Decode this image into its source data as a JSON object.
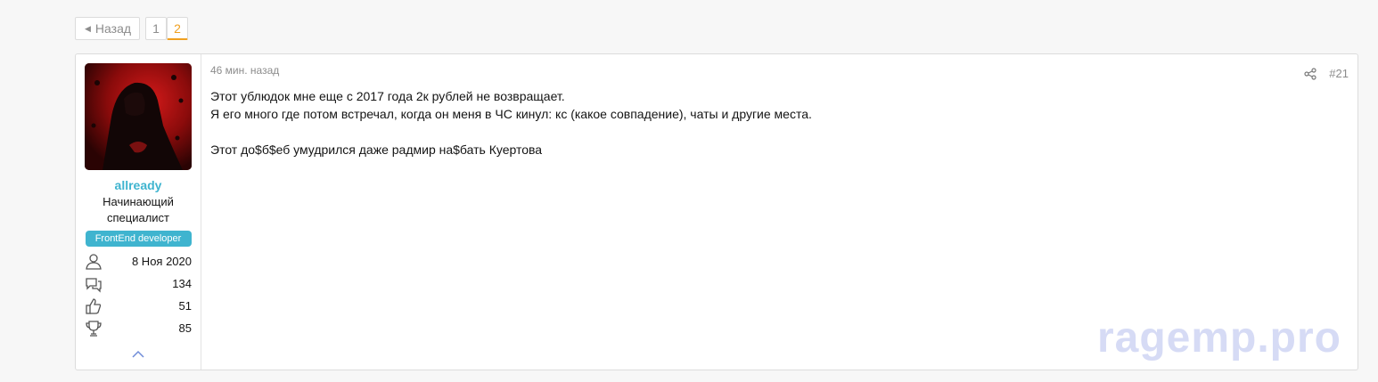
{
  "pagination": {
    "prev_label": "Назад",
    "pages": [
      "1",
      "2"
    ],
    "current": "2"
  },
  "post": {
    "author": {
      "name": "allready",
      "title": "Начинающий специалист",
      "badge": "FrontEnd developer",
      "stats": [
        {
          "icon": "user-icon",
          "value": "8 Ноя 2020"
        },
        {
          "icon": "messages-icon",
          "value": "134"
        },
        {
          "icon": "thumbs-up-icon",
          "value": "51"
        },
        {
          "icon": "trophy-icon",
          "value": "85"
        }
      ]
    },
    "date": "46 мин. назад",
    "number": "#21",
    "body": [
      "Этот ублюдок мне еще с 2017 года 2к рублей не возвращает.",
      "Я его много где потом встречал, когда он меня в ЧС кинул: кс (какое совпадение), чаты и другие места.",
      "",
      "Этот до$б$еб умудрился даже радмир на$бать Куертова"
    ]
  },
  "watermark": "ragemp.pro",
  "colors": {
    "accent": "#3fb4cf",
    "current_page": "#f0a020",
    "muted": "#8c8c8c",
    "watermark": "#c9cff2"
  }
}
